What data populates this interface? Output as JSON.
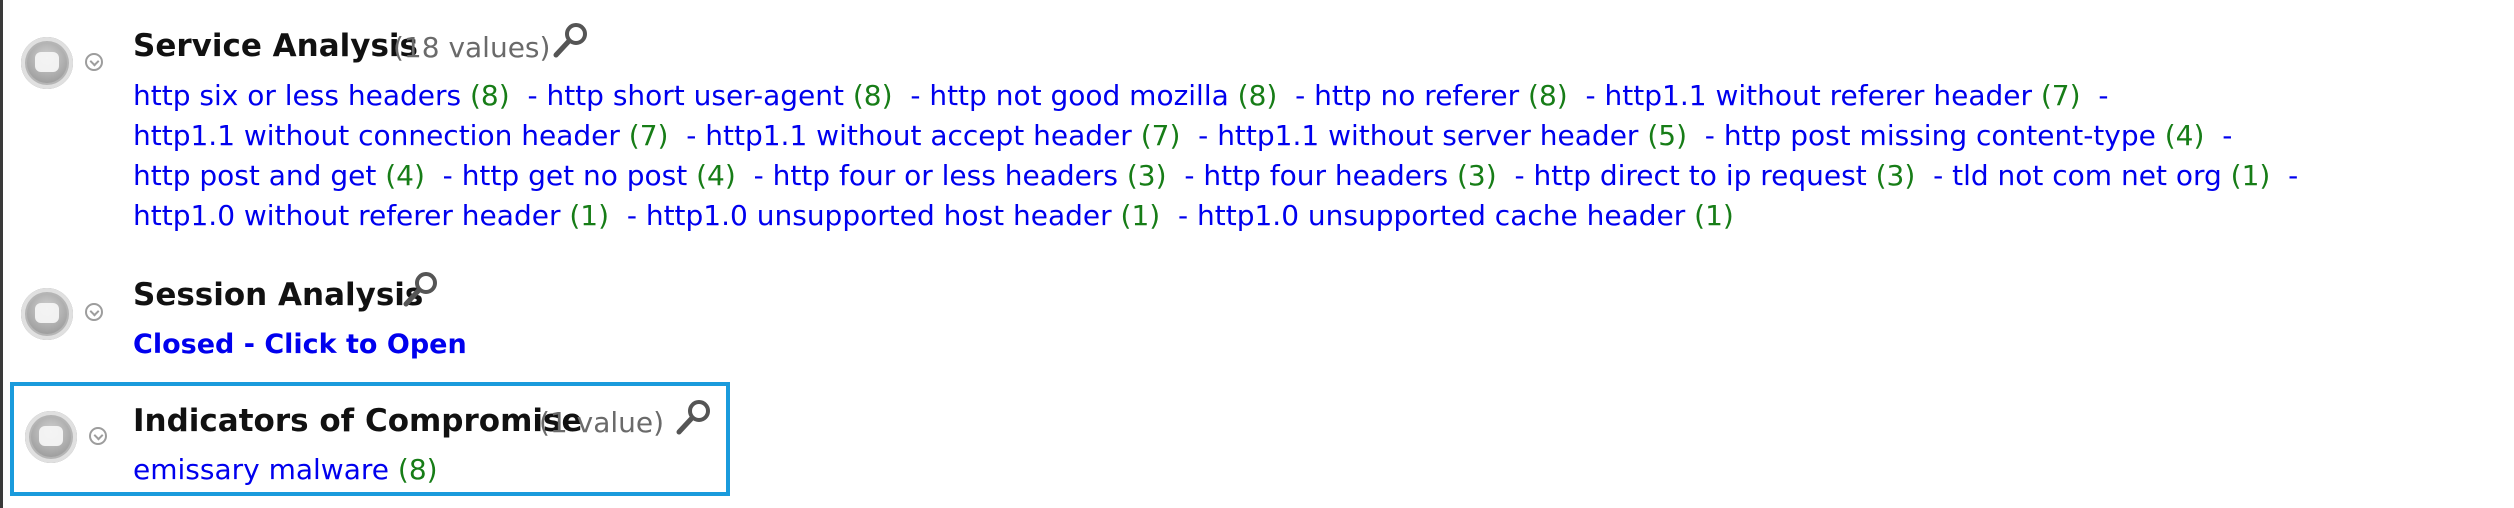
{
  "sections": [
    {
      "title": "Service Analysis",
      "count_label": "(18 values)",
      "values": [
        {
          "label": "http six or less headers",
          "count": "(8)"
        },
        {
          "label": "http short user-agent",
          "count": "(8)"
        },
        {
          "label": "http not good mozilla",
          "count": "(8)"
        },
        {
          "label": "http no referer",
          "count": "(8)"
        },
        {
          "label": "http1.1 without referer header",
          "count": "(7)"
        },
        {
          "label": "http1.1 without connection header",
          "count": "(7)"
        },
        {
          "label": "http1.1 without accept header",
          "count": "(7)"
        },
        {
          "label": "http1.1 without server header",
          "count": "(5)"
        },
        {
          "label": "http post missing content-type",
          "count": "(4)"
        },
        {
          "label": "http post and get",
          "count": "(4)"
        },
        {
          "label": "http get no post",
          "count": "(4)"
        },
        {
          "label": "http four or less headers",
          "count": "(3)"
        },
        {
          "label": "http four headers",
          "count": "(3)"
        },
        {
          "label": "http direct to ip request",
          "count": "(3)"
        },
        {
          "label": "tld not com net org",
          "count": "(1)"
        },
        {
          "label": "http1.0 without referer header",
          "count": "(1)"
        },
        {
          "label": "http1.0 unsupported host header",
          "count": "(1)"
        },
        {
          "label": "http1.0 unsupported cache header",
          "count": "(1)"
        }
      ]
    },
    {
      "title": "Session Analysis",
      "status_link": "Closed - Click to Open"
    },
    {
      "title": "Indicators of Compromise",
      "count_label": "(1 value)",
      "values": [
        {
          "label": "emissary malware",
          "count": "(8)"
        }
      ]
    }
  ],
  "separator": "-",
  "colors": {
    "link": "#0000ee",
    "count": "#177d17",
    "highlight_border": "#1a9bdc"
  },
  "icons": {
    "handle": "drag-handle-icon",
    "expand": "chevron-down-icon",
    "search": "magnifier-icon"
  }
}
